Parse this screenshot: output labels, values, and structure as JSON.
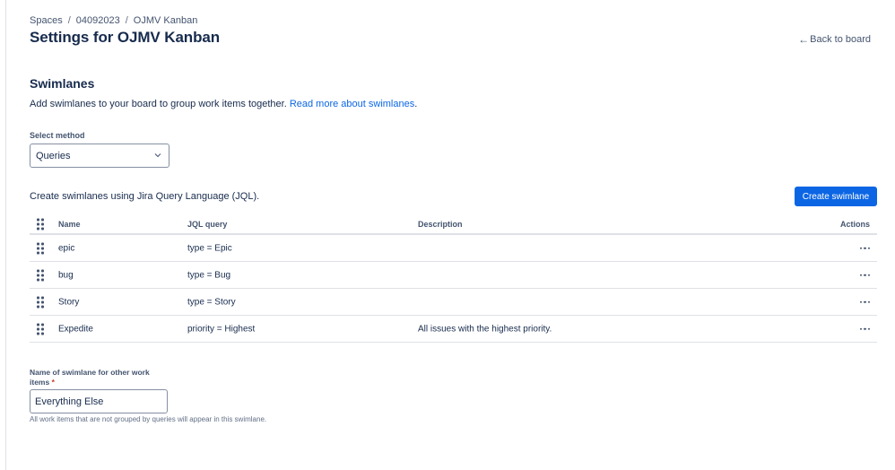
{
  "breadcrumb": [
    "Spaces",
    "04092023",
    "OJMV Kanban"
  ],
  "breadcrumb_separator": "/",
  "page_title": "Settings for OJMV Kanban",
  "back_link": "Back to board",
  "swimlanes": {
    "title": "Swimlanes",
    "description": "Add swimlanes to your board to group work items together.",
    "read_more": "Read more about swimlanes",
    "period": "."
  },
  "select_method": {
    "label": "Select method",
    "value": "Queries"
  },
  "jql_intro": "Create swimlanes using Jira Query Language (JQL).",
  "create_button": "Create swimlane",
  "table": {
    "headers": {
      "name": "Name",
      "jql": "JQL query",
      "description": "Description",
      "actions": "Actions"
    },
    "rows": [
      {
        "name": "epic",
        "jql": "type = Epic",
        "description": ""
      },
      {
        "name": "bug",
        "jql": "type = Bug",
        "description": ""
      },
      {
        "name": "Story",
        "jql": "type = Story",
        "description": ""
      },
      {
        "name": "Expedite",
        "jql": "priority = Highest",
        "description": "All issues with the highest priority."
      }
    ]
  },
  "other_swimlane": {
    "label": "Name of swimlane for other work items",
    "required_mark": "*",
    "value": "Everything Else",
    "helper": "All work items that are not grouped by queries will appear in this swimlane."
  },
  "colors": {
    "primary": "#0c66e4",
    "text": "#172b4d",
    "subtle": "#44546f",
    "border": "#dfe1e6"
  },
  "icons": {
    "back": "arrow-left-icon",
    "select": "chevron-down-icon",
    "row_drag": "drag-handle-icon",
    "row_actions": "more-icon"
  }
}
